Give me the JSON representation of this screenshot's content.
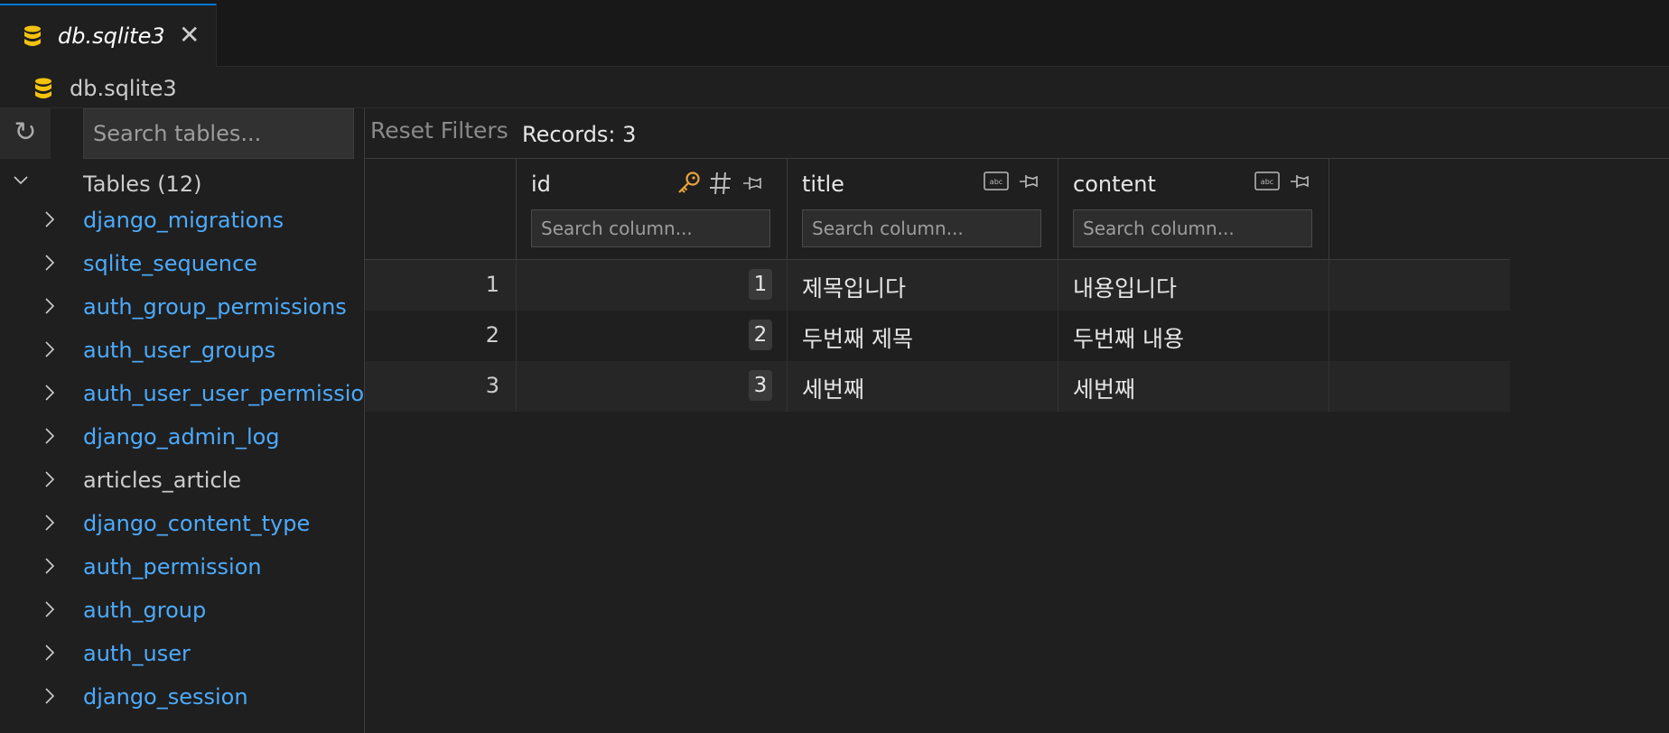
{
  "tab": {
    "title": "db.sqlite3",
    "close_glyph": "✕"
  },
  "breadcrumb": {
    "label": "db.sqlite3"
  },
  "sidebar": {
    "refresh_glyph": "↻",
    "search_placeholder": "Search tables...",
    "tables_header": "Tables (12)",
    "tables": [
      {
        "name": "django_migrations"
      },
      {
        "name": "sqlite_sequence"
      },
      {
        "name": "auth_group_permissions"
      },
      {
        "name": "auth_user_groups"
      },
      {
        "name": "auth_user_user_permissions"
      },
      {
        "name": "django_admin_log"
      },
      {
        "name": "articles_article"
      },
      {
        "name": "django_content_type"
      },
      {
        "name": "auth_permission"
      },
      {
        "name": "auth_group"
      },
      {
        "name": "auth_user"
      },
      {
        "name": "django_session"
      }
    ]
  },
  "toolbar": {
    "reset_label": "Reset Filters",
    "records_label": "Records: 3"
  },
  "grid": {
    "columns": [
      {
        "name": "id",
        "search_placeholder": "Search column...",
        "icons": [
          "key-icon",
          "hash-icon",
          "pin-icon"
        ]
      },
      {
        "name": "title",
        "search_placeholder": "Search column...",
        "icons": [
          "abc-icon",
          "pin-icon"
        ]
      },
      {
        "name": "content",
        "search_placeholder": "Search column...",
        "icons": [
          "abc-icon",
          "pin-icon"
        ]
      }
    ],
    "rows": [
      {
        "rownum": "1",
        "id": "1",
        "title": "제목입니다",
        "content": "내용입니다"
      },
      {
        "rownum": "2",
        "id": "2",
        "title": "두번째 제목",
        "content": "두번째 내용"
      },
      {
        "rownum": "3",
        "id": "3",
        "title": "세번째",
        "content": "세번째"
      }
    ]
  },
  "colors": {
    "background": "#1f1f1f",
    "accent": "#0078d4",
    "link": "#4daafc",
    "db_icon": "#f4c20d",
    "key_icon": "#e8a33d"
  }
}
